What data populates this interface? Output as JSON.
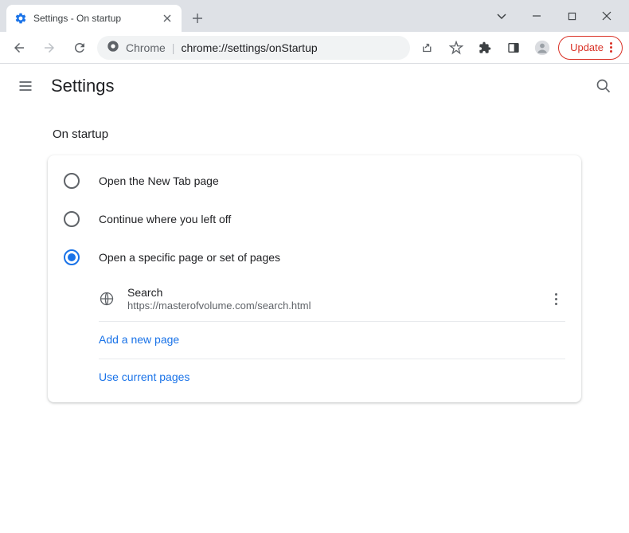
{
  "tab": {
    "title": "Settings - On startup"
  },
  "omnibox": {
    "scheme": "Chrome",
    "url": "chrome://settings/onStartup"
  },
  "updateChip": {
    "label": "Update"
  },
  "header": {
    "title": "Settings"
  },
  "section": {
    "title": "On startup"
  },
  "options": {
    "newTab": "Open the New Tab page",
    "continue": "Continue where you left off",
    "specific": "Open a specific page or set of pages"
  },
  "pages": [
    {
      "name": "Search",
      "url": "https://masterofvolume.com/search.html"
    }
  ],
  "links": {
    "addPage": "Add a new page",
    "useCurrent": "Use current pages"
  }
}
